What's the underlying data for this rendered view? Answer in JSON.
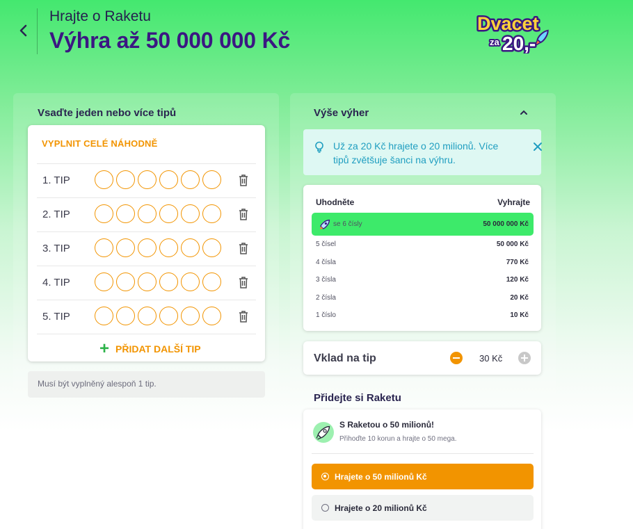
{
  "header": {
    "subtitle": "Hrajte o Raketu",
    "title": "Výhra až 50 000 000 Kč",
    "logo": {
      "line1": "Dvacet",
      "line2": "za",
      "line3": "20,-"
    }
  },
  "tips": {
    "section_title": "Vsaďte jeden nebo více tipů",
    "random_fill_label": "VYPLNIT CELÉ NÁHODNĚ",
    "rows": [
      {
        "label": "1. TIP"
      },
      {
        "label": "2. TIP"
      },
      {
        "label": "3. TIP"
      },
      {
        "label": "4. TIP"
      },
      {
        "label": "5. TIP"
      }
    ],
    "add_tip_label": "PŘIDAT DALŠÍ TIP",
    "note": "Musí být vyplněný alespoň 1 tip."
  },
  "prizes": {
    "section_title": "Výše výher",
    "info_text": "Už za 20 Kč hrajete o 20 milionů. Více tipů zvětšuje šanci na výhru.",
    "col_guess": "Uhodněte",
    "col_win": "Vyhrajte",
    "rows": [
      {
        "guess": "se 6 čísly",
        "win": "50 000 000 Kč"
      },
      {
        "guess": "5 čísel",
        "win": "50 000 Kč"
      },
      {
        "guess": "4 čísla",
        "win": "770 Kč"
      },
      {
        "guess": "3 čísla",
        "win": "120 Kč"
      },
      {
        "guess": "2 čísla",
        "win": "20 Kč"
      },
      {
        "guess": "1 číslo",
        "win": "10 Kč"
      }
    ]
  },
  "stake": {
    "label": "Vklad na tip",
    "value": "30 Kč"
  },
  "raketa": {
    "section_title": "Přidejte si Raketu",
    "heading": "S Raketou o 50 milionů!",
    "subtext": "Přihoďte 10 korun a hrajte o 50 mega.",
    "options": [
      {
        "label": "Hrajete o 50 milionů Kč",
        "selected": true
      },
      {
        "label": "Hrajete o 20 milionů Kč",
        "selected": false
      }
    ]
  },
  "colors": {
    "accent_orange": "#f29400",
    "brand_purple": "#3b1782",
    "highlight_green": "#3dea6a",
    "info_blue": "#1f9ec0"
  }
}
